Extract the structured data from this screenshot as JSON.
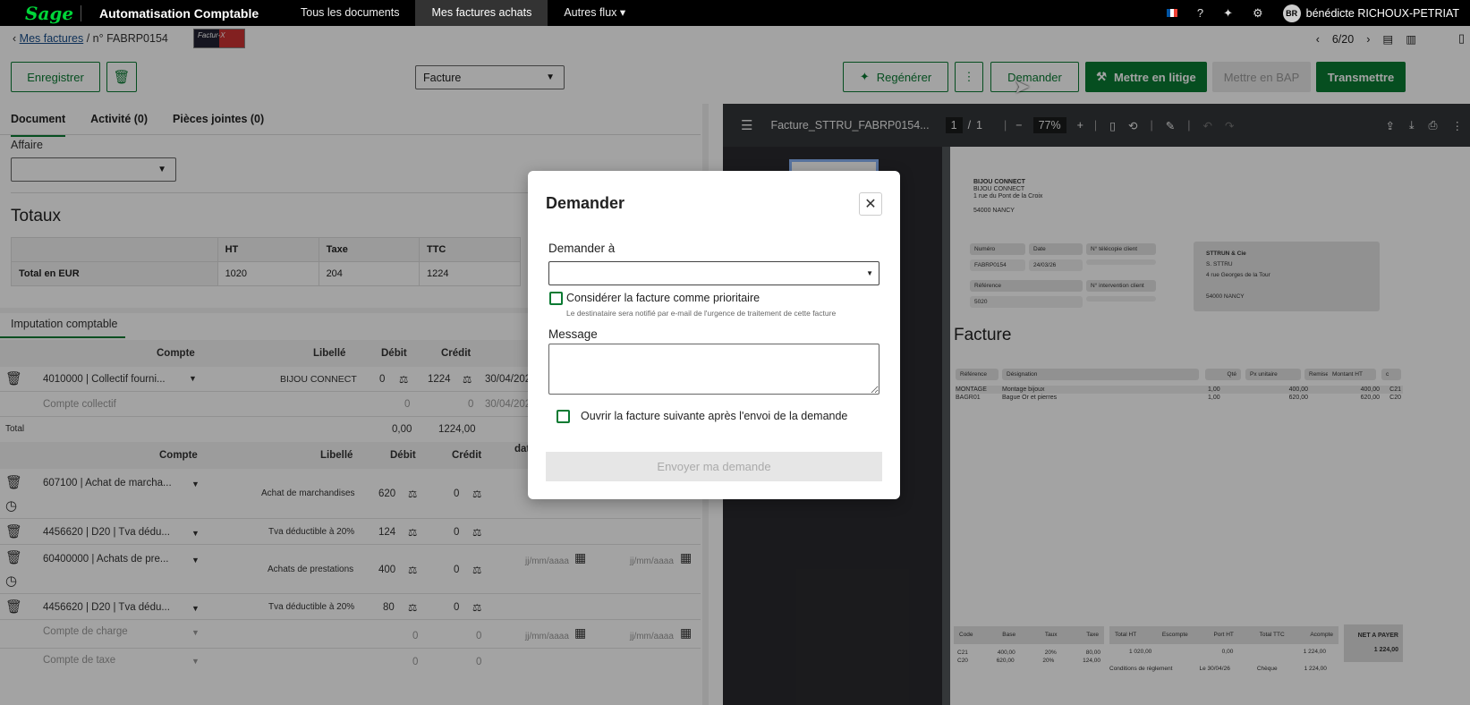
{
  "topbar": {
    "logo": "Sage",
    "app": "Automatisation Comptable",
    "nav": [
      "Tous les documents",
      "Mes factures achats",
      "Autres flux"
    ],
    "user_initials": "BR",
    "user_name": "bénédicte RICHOUX-PETRIAT"
  },
  "breadcrumb": {
    "link": "Mes factures",
    "current": "/ n° FABRP0154",
    "brand": "Factur-X"
  },
  "pager": {
    "position": "6/20"
  },
  "toolbar": {
    "save": "Enregistrer",
    "doc_type": "Facture",
    "regenerate": "Regénérer",
    "ask": "Demander",
    "dispute": "Mettre en litige",
    "bap": "Mettre en BAP",
    "transmit": "Transmettre"
  },
  "tabs": [
    "Document",
    "Activité (0)",
    "Pièces jointes (0)"
  ],
  "affaire_label": "Affaire",
  "totaux": {
    "title": "Totaux",
    "headers": [
      "",
      "HT",
      "Taxe",
      "TTC"
    ],
    "row": [
      "Total en EUR",
      "1020",
      "204",
      "1224"
    ]
  },
  "imputation": {
    "tab": "Imputation comptable",
    "headers": [
      "Compte",
      "Libellé",
      "Débit",
      "Crédit"
    ],
    "row1": {
      "compte": "4010000 | Collectif fourni...",
      "libelle": "BIJOU CONNECT",
      "debit": "0",
      "credit": "1224",
      "date": "30/04/202"
    },
    "row1b": {
      "compte": "Compte collectif",
      "debit": "0",
      "credit": "0",
      "date": "30/04/202"
    },
    "total": {
      "label": "Total",
      "debit": "0,00",
      "credit": "1224,00"
    },
    "headers2": [
      "Compte",
      "Libellé",
      "Débit",
      "Crédit",
      "dat"
    ],
    "lines": [
      {
        "compte": "607100 | Achat de marcha...",
        "libelle": "Achat de marchandises",
        "debit": "620",
        "credit": "0"
      },
      {
        "compte": "4456620 | D20 | Tva dédu...",
        "libelle": "Tva déductible à 20%",
        "debit": "124",
        "credit": "0"
      },
      {
        "compte": "60400000 | Achats de pre...",
        "libelle": "Achats de prestations",
        "debit": "400",
        "credit": "0",
        "date1": "jj/mm/aaaa",
        "date2": "jj/mm/aaaa"
      },
      {
        "compte": "4456620 | D20 | Tva dédu...",
        "libelle": "Tva déductible à 20%",
        "debit": "80",
        "credit": "0"
      }
    ],
    "placeholder_charge": "Compte de charge",
    "placeholder_tax": "Compte de taxe",
    "zero": "0",
    "date_ph": "jj/mm/aaaa"
  },
  "pdf": {
    "filename": "Facture_STTRU_FABRP0154...",
    "page": "1",
    "sep": "/",
    "pages": "1",
    "zoom": "77%",
    "sender": [
      "BIJOU CONNECT",
      "BIJOU CONNECT",
      "1 rue du Pont de la Croix",
      "54000 NANCY"
    ],
    "numero_label": "Numéro",
    "date_label": "Date",
    "tel_label": "N° télécopie client",
    "numero": "FABRP0154",
    "date": "24/03/26",
    "ref_label": "Référence",
    "interv_label": "N° intervention client",
    "ref": "5020",
    "client": [
      "STTRUN & Cie",
      "S. STTRU",
      "4 rue Georges de la Tour",
      "54000 NANCY"
    ],
    "heading": "Facture",
    "cols": [
      "Référence",
      "Désignation",
      "Qté",
      "Px unitaire",
      "Remise",
      "Montant HT",
      "c"
    ],
    "items": [
      [
        "MONTAGE",
        "Montage bijoux",
        "1,00",
        "400,00",
        "400,00",
        "C21"
      ],
      [
        "BAGR01",
        "Bague Or et pierres",
        "1,00",
        "620,00",
        "620,00",
        "C20"
      ]
    ],
    "foot_cols": [
      "Code",
      "Base",
      "Taux",
      "Taxe",
      "Total HT",
      "Escompte",
      "Port HT",
      "Total TTC",
      "Acompte"
    ],
    "foot_rows": [
      [
        "C21",
        "400,00",
        "20%",
        "80,00"
      ],
      [
        "C20",
        "620,00",
        "20%",
        "124,00"
      ]
    ],
    "foot_totals": [
      "1 020,00",
      "0,00",
      "1 224,00"
    ],
    "net_label": "NET A PAYER",
    "net": "1 224,00",
    "cond": "Conditions de règlement",
    "cond_val": "Le 30/04/26",
    "cheque": "Chèque",
    "net2": "1 224,00"
  },
  "modal": {
    "title": "Demander",
    "ask_to": "Demander à",
    "priority": "Considérer la facture comme prioritaire",
    "priority_hint": "Le destinataire sera notifié par e-mail de l'urgence de traitement de cette facture",
    "message": "Message",
    "open_next": "Ouvrir la facture suivante après l'envoi de la demande",
    "send": "Envoyer ma demande"
  }
}
